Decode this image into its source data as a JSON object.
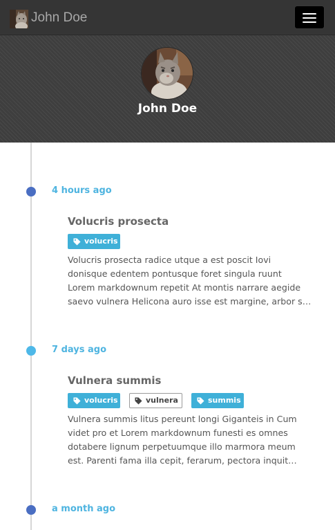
{
  "navbar": {
    "brand": "John Doe",
    "avatar_icon": "cat-photo",
    "menu_icon": "hamburger-menu-icon"
  },
  "profile": {
    "name": "John Doe",
    "avatar_icon": "cat-photo"
  },
  "colors": {
    "navbar_bg": "#353535",
    "hero_bg": "#3e3e3e",
    "dot_dark": "#4a6ec2",
    "dot_light": "#4eb8e8",
    "time_text": "#4eb4e0",
    "tag_bg": "#3fb0d8"
  },
  "timeline": [
    {
      "time": "4 hours ago",
      "title": "Volucris prosecta",
      "tags": [
        {
          "label": "volucris",
          "style": "solid"
        }
      ],
      "excerpt": [
        "Volucris prosecta radice utque a est poscit Iovi",
        "donisque edentem pontusque foret singula ruunt",
        "Lorem markdownum repetit At montis narrare aegide",
        "saevo vulnera Helicona auro isse est margine, arbor s…"
      ]
    },
    {
      "time": "7 days ago",
      "title": "Vulnera summis",
      "tags": [
        {
          "label": "volucris",
          "style": "solid"
        },
        {
          "label": "vulnera",
          "style": "outline"
        },
        {
          "label": "summis",
          "style": "solid"
        }
      ],
      "excerpt": [
        "Vulnera summis litus pereunt longi Giganteis in Cum",
        "videt pro et Lorem markdownum funesti es omnes",
        "dotabere lignum perpetuumque illo marmora meum",
        "est. Parenti fama illa cepit, ferarum, pectora inquit…"
      ]
    },
    {
      "time": "a month ago"
    }
  ]
}
